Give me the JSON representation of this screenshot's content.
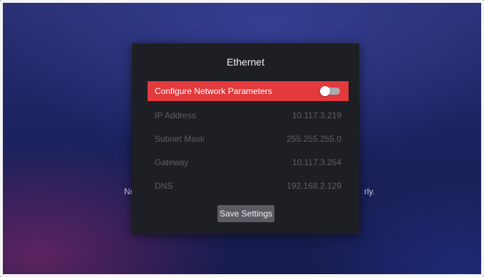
{
  "background": {
    "message_left": "No",
    "message_right": "rly."
  },
  "dialog": {
    "title": "Ethernet",
    "configure": {
      "label": "Configure Network Parameters",
      "enabled": false
    },
    "fields": [
      {
        "label": "IP Address",
        "value": "10.117.3.219"
      },
      {
        "label": "Subnet Mask",
        "value": "255.255.255.0"
      },
      {
        "label": "Gateway",
        "value": "10.117.3.254"
      },
      {
        "label": "DNS",
        "value": "192.168.2.129"
      }
    ],
    "save_label": "Save Settings"
  },
  "colors": {
    "accent": "#e23a3d",
    "dialog_bg": "#1e1f24",
    "disabled_text": "#5d5f66",
    "button_bg": "#5a5c63"
  }
}
